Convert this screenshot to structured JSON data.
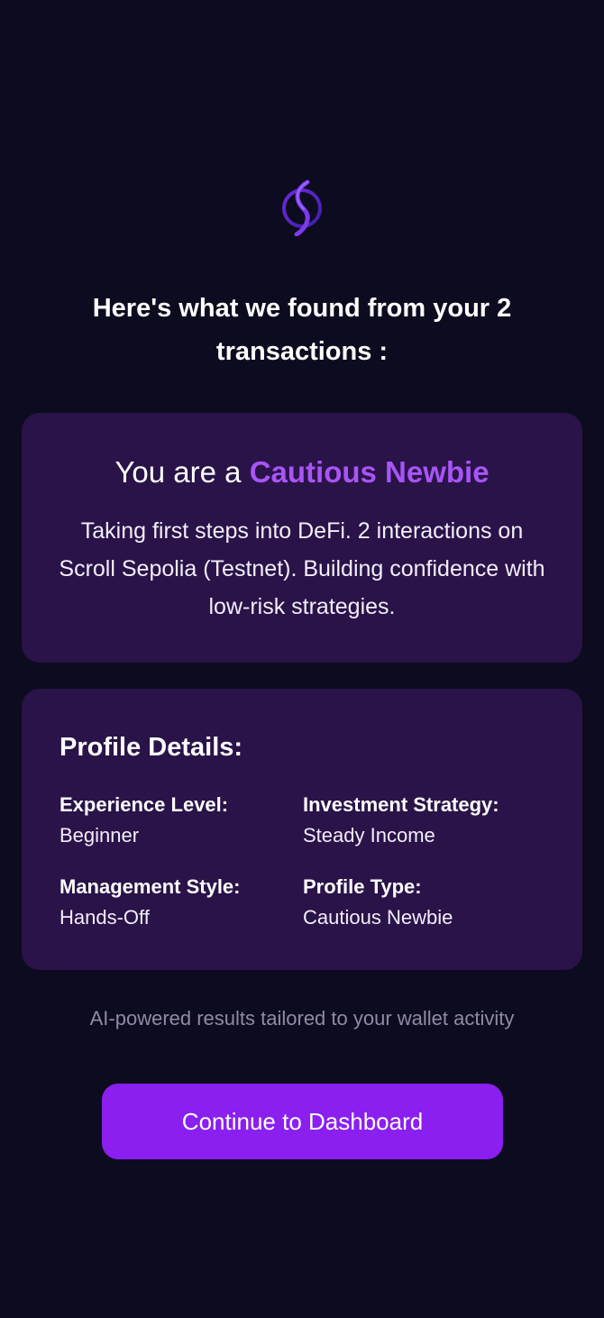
{
  "header": {
    "logo_icon": "swirl-logo-icon",
    "headline": "Here's what we found from your 2 transactions :"
  },
  "result": {
    "prefix": "You are a ",
    "persona": "Cautious Newbie",
    "description": "Taking first steps into DeFi. 2 interactions on Scroll Sepolia (Testnet). Building confidence with low-risk strategies."
  },
  "profile": {
    "heading": "Profile Details:",
    "details": [
      {
        "label": "Experience Level:",
        "value": "Beginner"
      },
      {
        "label": "Investment Strategy:",
        "value": "Steady Income"
      },
      {
        "label": "Management Style:",
        "value": "Hands-Off"
      },
      {
        "label": "Profile Type:",
        "value": "Cautious Newbie"
      }
    ]
  },
  "footnote": "AI-powered results tailored to your wallet activity",
  "cta": {
    "label": "Continue to Dashboard"
  },
  "colors": {
    "background": "#0d0b1f",
    "card": "#2a1348",
    "accent": "#a855f7",
    "button": "#8a1ff0",
    "muted_text": "#8f8ba3"
  }
}
